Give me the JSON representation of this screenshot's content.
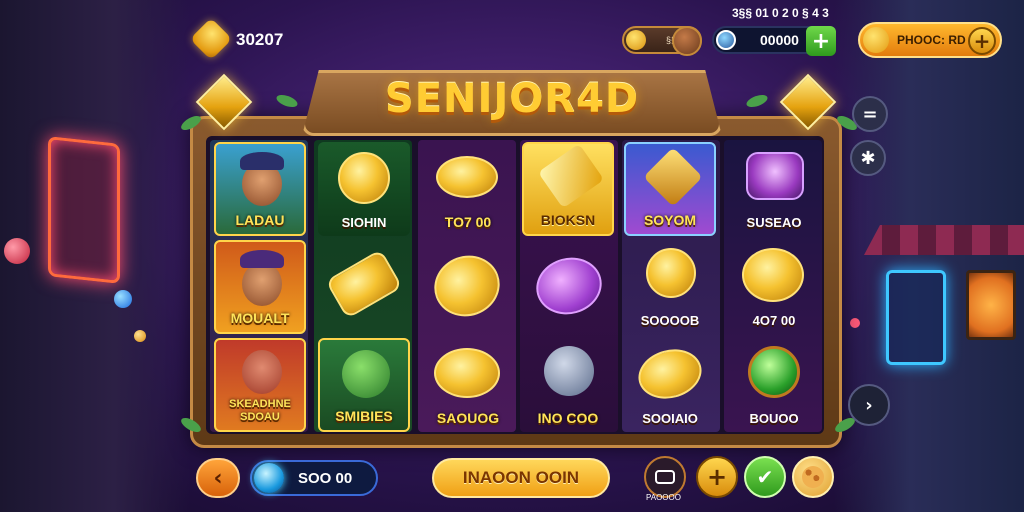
{
  "header": {
    "left_value": "30207",
    "small_pill_text": "§§§ §§",
    "time": "3§§ 01  0 2  0 § 4 3",
    "gem_value": "00000",
    "big_pill_label": "PHOOC: RD"
  },
  "title": "SENIJOR4D",
  "reels": [
    [
      "LADAU",
      "MOUALT",
      "SKEADHNE SDOAU"
    ],
    [
      "SIOHIN",
      "",
      "SMIBIES"
    ],
    [
      "TO7 00",
      "",
      "SAOUOG"
    ],
    [
      "BIOKSN",
      "",
      "INO COO"
    ],
    [
      "SOYOM",
      "SOOOOB",
      "SOOIAIO"
    ],
    [
      "SUSEAO",
      "4O7 00",
      "BOUOO"
    ]
  ],
  "bottom": {
    "back_icon": "‹",
    "balance": "SOO 00",
    "main_button": "INAOON OOIN",
    "menu_label": "PAOOOO"
  },
  "side": {
    "top_icon": "=",
    "second_icon": "✱",
    "arrow_icon": "›"
  },
  "colors": {
    "gold": "#ffcc33",
    "accent_green": "#2f9a1d",
    "accent_orange": "#e37b0c"
  }
}
